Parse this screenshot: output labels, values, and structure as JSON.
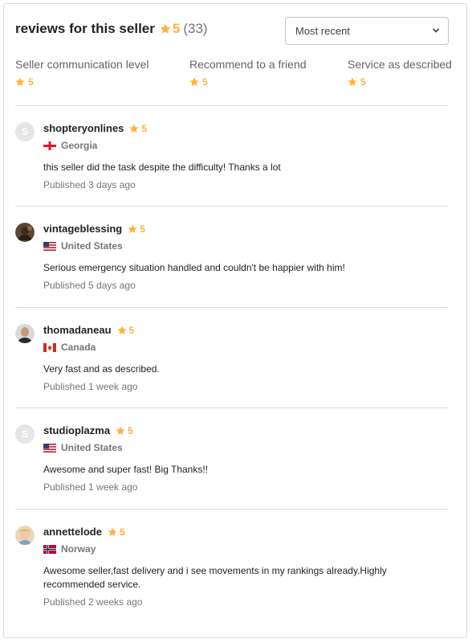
{
  "header": {
    "title": "reviews for this seller",
    "score": "5",
    "count": "(33)",
    "accent_color": "#ffb33e",
    "star_icon": "star-icon"
  },
  "sort": {
    "selected": "Most recent",
    "icon": "chevron-down-icon"
  },
  "ratings": [
    {
      "label": "Seller communication level",
      "value": "5"
    },
    {
      "label": "Recommend to a friend",
      "value": "5"
    },
    {
      "label": "Service as described",
      "value": "5"
    }
  ],
  "reviews": [
    {
      "username": "shopteryonlines",
      "avatar_letter": "S",
      "score": "5",
      "country": "Georgia",
      "flag_icon": "georgia-flag-icon",
      "text": "this seller did the task despite the difficulty! Thanks a lot",
      "published": "Published 3 days ago"
    },
    {
      "username": "vintageblessing",
      "avatar_letter": "",
      "score": "5",
      "country": "United States",
      "flag_icon": "us-flag-icon",
      "text": "Serious emergency situation handled and couldn't be happier with him!",
      "published": "Published 5 days ago"
    },
    {
      "username": "thomadaneau",
      "avatar_letter": "",
      "score": "5",
      "country": "Canada",
      "flag_icon": "canada-flag-icon",
      "text": "Very fast and as described.",
      "published": "Published 1 week ago"
    },
    {
      "username": "studioplazma",
      "avatar_letter": "S",
      "score": "5",
      "country": "United States",
      "flag_icon": "us-flag-icon",
      "text": "Awesome and super fast! Big Thanks!!",
      "published": "Published 1 week ago"
    },
    {
      "username": "annettelode",
      "avatar_letter": "",
      "score": "5",
      "country": "Norway",
      "flag_icon": "norway-flag-icon",
      "text": "Awesome seller,fast delivery and i see movements in my rankings already.Highly recommended service.",
      "published": "Published 2 weeks ago"
    }
  ]
}
